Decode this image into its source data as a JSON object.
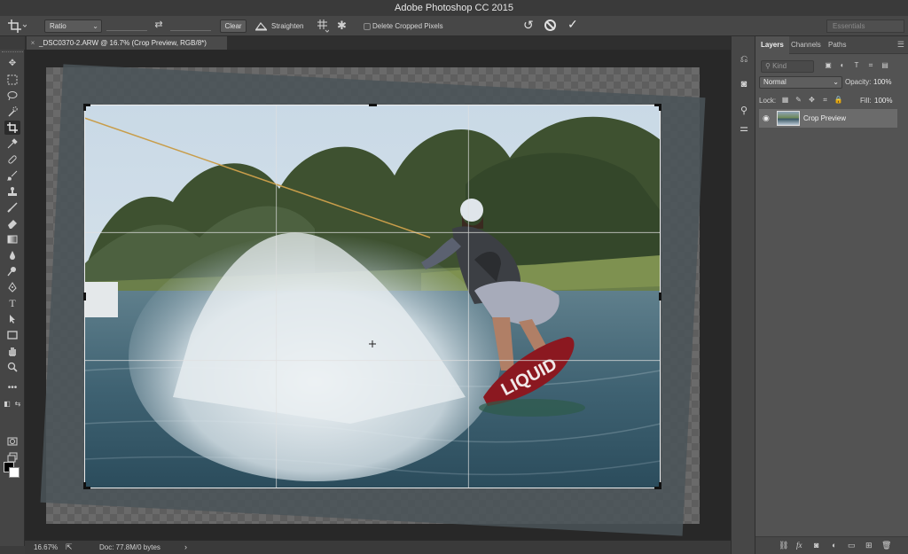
{
  "app": {
    "title": "Adobe Photoshop CC 2015"
  },
  "options_bar": {
    "ratio": "Ratio",
    "swap_icon": "swap-arrows-icon",
    "clear": "Clear",
    "straighten": "Straighten",
    "delete_cropped": "Delete Cropped Pixels",
    "workspace": "Essentials"
  },
  "document": {
    "tab_title": "_DSC0370-2.ARW @ 16.7% (Crop Preview, RGB/8*)",
    "tab_close": "×"
  },
  "tools": [
    "move",
    "marquee",
    "lasso",
    "quick-select",
    "crop",
    "eyedropper",
    "healing",
    "brush",
    "clone-stamp",
    "history-brush",
    "eraser",
    "gradient",
    "blur",
    "dodge",
    "pen",
    "type",
    "path-select",
    "rectangle",
    "hand",
    "zoom",
    "more"
  ],
  "colors": {
    "foreground": "#000000",
    "background": "#ffffff"
  },
  "status": {
    "zoom": "16.67%",
    "doc": "Doc: 77.8M/0 bytes"
  },
  "layers_panel": {
    "tabs": [
      "Layers",
      "Channels",
      "Paths"
    ],
    "kind": "Kind",
    "blend_mode": "Normal",
    "opacity_label": "Opacity:",
    "opacity_value": "100%",
    "lock_label": "Lock:",
    "fill_label": "Fill:",
    "fill_value": "100%",
    "layers": [
      {
        "name": "Crop Preview",
        "visible": true
      }
    ]
  }
}
